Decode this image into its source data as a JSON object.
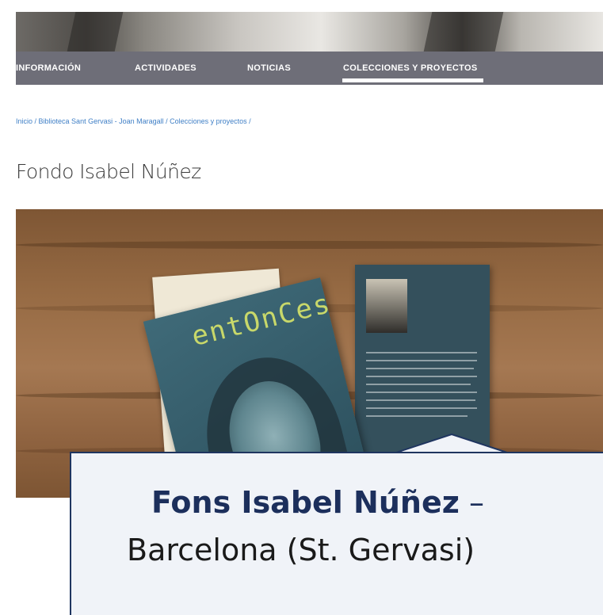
{
  "nav": {
    "items": [
      {
        "label": "INFORMACIÓN"
      },
      {
        "label": "ACTIVIDADES"
      },
      {
        "label": "NOTICIAS"
      },
      {
        "label": "COLECCIONES Y PROYECTOS",
        "active": true
      }
    ]
  },
  "breadcrumb": {
    "items": [
      "Inicio",
      "Biblioteca Sant Gervasi - Joan Maragall",
      "Colecciones y proyectos"
    ],
    "separator": " / "
  },
  "page": {
    "title": "Fondo Isabel Núñez"
  },
  "photo": {
    "book_title": "entOnCes"
  },
  "callout": {
    "name": "Fons Isabel Núñez",
    "dash": " –",
    "location": "Barcelona (St. Gervasi)"
  },
  "colors": {
    "nav_background": "#6e6e78",
    "link": "#3f7fc6",
    "callout_border": "#1f3560",
    "callout_text": "#1c2f5c"
  }
}
